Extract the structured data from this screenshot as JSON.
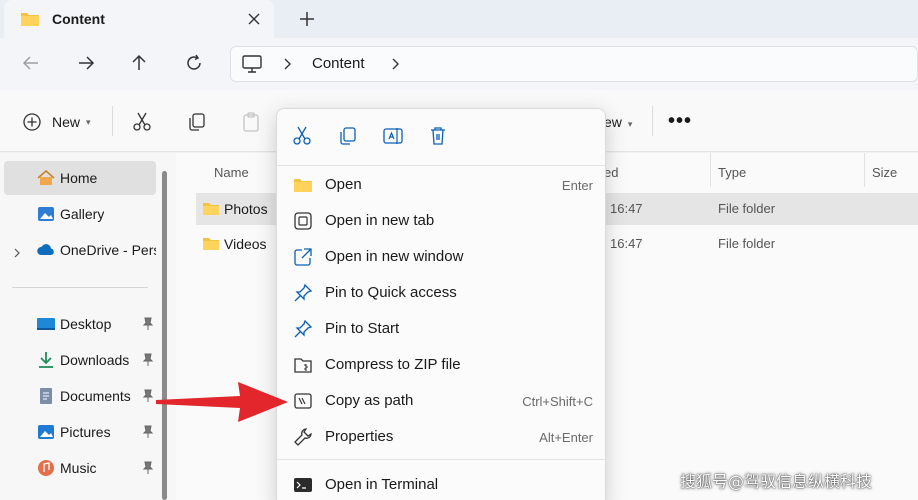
{
  "window": {
    "tab_title": "Content",
    "icons": {
      "tab": "folder-icon",
      "close": "close-icon",
      "new_tab": "plus-icon"
    }
  },
  "navigation": {
    "back": "back-arrow-icon",
    "forward": "forward-arrow-icon",
    "up": "up-arrow-icon",
    "refresh": "refresh-icon",
    "breadcrumb": [
      "Content"
    ]
  },
  "commandbar": {
    "new_label": "New",
    "view_label": "ew",
    "more": "•••"
  },
  "sidebar": {
    "items": [
      {
        "label": "Home",
        "icon": "home-icon",
        "selected": true
      },
      {
        "label": "Gallery",
        "icon": "gallery-icon"
      },
      {
        "label": "OneDrive - Perso",
        "icon": "cloud-icon",
        "expandable": true
      },
      {
        "label": "Desktop",
        "icon": "desktop-icon",
        "pinned": true
      },
      {
        "label": "Downloads",
        "icon": "download-icon",
        "pinned": true
      },
      {
        "label": "Documents",
        "icon": "document-icon",
        "pinned": true
      },
      {
        "label": "Pictures",
        "icon": "pictures-icon",
        "pinned": true
      },
      {
        "label": "Music",
        "icon": "music-icon",
        "pinned": true
      }
    ]
  },
  "files": {
    "columns": {
      "name": "Name",
      "date": "ed",
      "type": "Type",
      "size": "Size"
    },
    "rows": [
      {
        "name": "Photos",
        "date": "16:47",
        "type": "File folder",
        "selected": true
      },
      {
        "name": "Videos",
        "date": "16:47",
        "type": "File folder"
      }
    ]
  },
  "context_menu": {
    "quick_actions": [
      "cut-icon",
      "copy-icon",
      "rename-icon",
      "delete-icon"
    ],
    "items": [
      {
        "label": "Open",
        "shortcut": "Enter",
        "icon": "folder-icon"
      },
      {
        "label": "Open in new tab",
        "shortcut": "",
        "icon": "new-tab-icon"
      },
      {
        "label": "Open in new window",
        "shortcut": "",
        "icon": "new-window-icon"
      },
      {
        "label": "Pin to Quick access",
        "shortcut": "",
        "icon": "pin-icon"
      },
      {
        "label": "Pin to Start",
        "shortcut": "",
        "icon": "pin-icon"
      },
      {
        "label": "Compress to ZIP file",
        "shortcut": "",
        "icon": "zip-icon"
      },
      {
        "label": "Copy as path",
        "shortcut": "Ctrl+Shift+C",
        "icon": "copy-path-icon"
      },
      {
        "label": "Properties",
        "shortcut": "Alt+Enter",
        "icon": "wrench-icon"
      },
      {
        "label": "Open in Terminal",
        "shortcut": "",
        "icon": "terminal-icon"
      }
    ]
  },
  "annotation": {
    "arrow_color": "#e3262b"
  },
  "watermark": "搜狐号@驾驭信息纵横科技",
  "colors": {
    "folder": "#f5c343",
    "accent": "#0067c0"
  }
}
